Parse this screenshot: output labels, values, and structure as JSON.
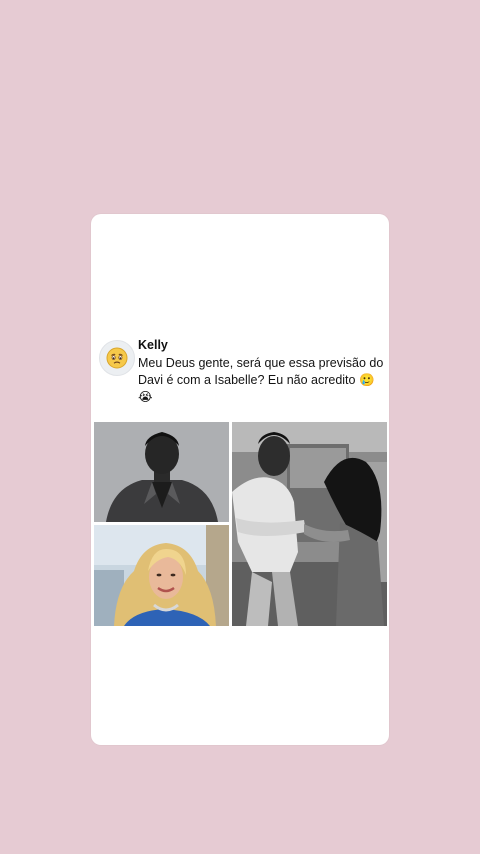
{
  "post": {
    "author": "Kelly",
    "text": "Meu Deus gente, será que essa previsão do Davi é com a Isabelle? Eu não acredito 🥲😭",
    "avatar_icon": "worried-face-emoji",
    "emojis": [
      "smiling-face-with-tear",
      "loudly-crying-face"
    ]
  },
  "colors": {
    "background": "#e6cbd3",
    "card": "#ffffff",
    "text": "#141414"
  }
}
